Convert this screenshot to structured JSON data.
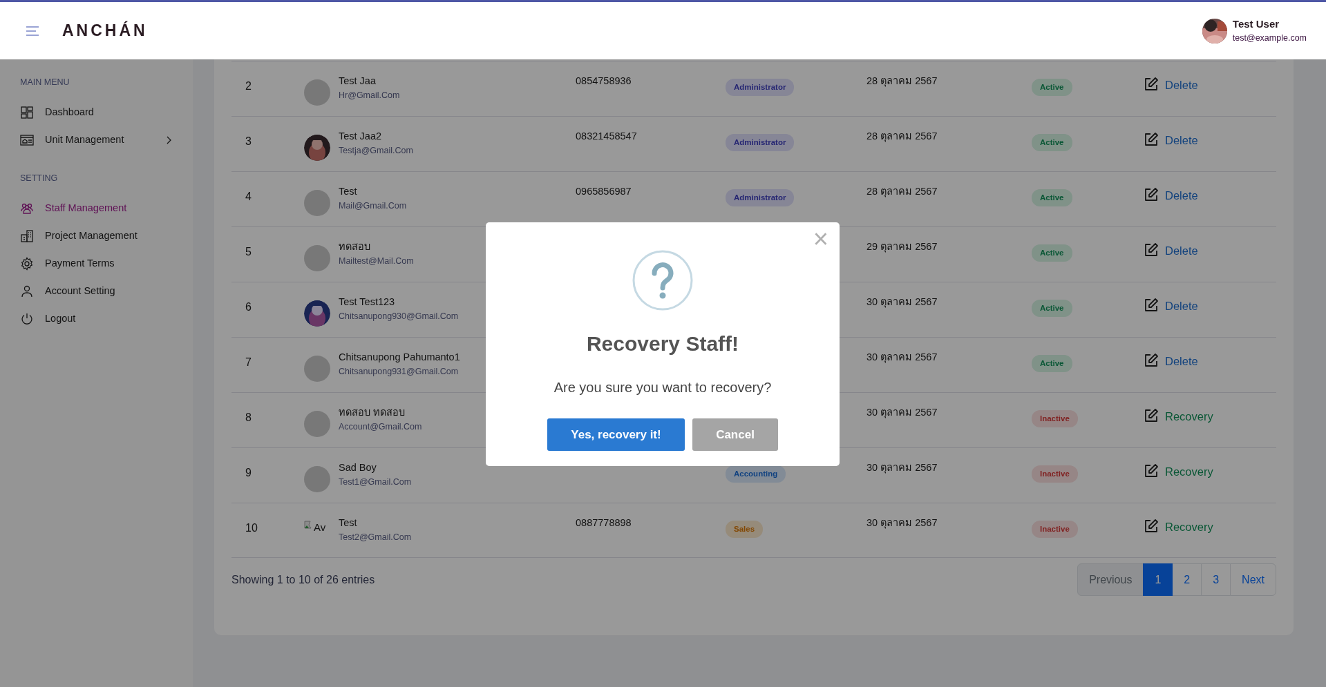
{
  "header": {
    "logo": "ANCHÁN",
    "user": {
      "name": "Test User",
      "email": "test@example.com"
    }
  },
  "sidebar": {
    "sections": [
      {
        "title": "MAIN MENU",
        "items": [
          {
            "label": "Dashboard",
            "kind": "link",
            "selected": false
          },
          {
            "label": "Unit Management",
            "kind": "submenu",
            "selected": false
          }
        ]
      },
      {
        "title": "SETTING",
        "items": [
          {
            "label": "Staff Management",
            "kind": "link",
            "selected": true
          },
          {
            "label": "Project Management",
            "kind": "link",
            "selected": false
          },
          {
            "label": "Payment Terms",
            "kind": "link",
            "selected": false
          },
          {
            "label": "Account Setting",
            "kind": "link",
            "selected": false
          },
          {
            "label": "Logout",
            "kind": "link",
            "selected": false
          }
        ]
      }
    ]
  },
  "staff_table": {
    "rows": [
      {
        "number": "2",
        "avatar": {
          "kind": "placeholder"
        },
        "name": "Test Jaa",
        "email": "Hr@Gmail.Com",
        "phone": "0854758936",
        "role": {
          "label": "Administrator",
          "kind": "admin"
        },
        "date": "28 ตุลาคม 2567",
        "status": "Active",
        "active": true,
        "action": "Delete"
      },
      {
        "number": "3",
        "name": "Test Jaa2",
        "email": "Testja@Gmail.Com",
        "phone": "08321458547",
        "role": {
          "label": "Administrator",
          "kind": "admin"
        },
        "date": "28 ตุลาคม 2567",
        "status": "Active",
        "active": true,
        "action": "Delete"
      },
      {
        "number": "4",
        "avatar": {
          "kind": "placeholder"
        },
        "name": "Test",
        "email": "Mail@Gmail.Com",
        "phone": "0965856987",
        "role": {
          "label": "Administrator",
          "kind": "admin"
        },
        "date": "28 ตุลาคม 2567",
        "status": "Active",
        "active": true,
        "action": "Delete"
      },
      {
        "number": "5",
        "avatar": {
          "kind": "placeholder"
        },
        "name": "ทดสอบ",
        "email": "Mailtest@Mail.Com",
        "date": "29 ตุลาคม 2567",
        "status": "Active",
        "active": true,
        "action": "Delete"
      },
      {
        "number": "6",
        "name": "Test Test123",
        "email": "Chitsanupong930@Gmail.Com",
        "date": "30 ตุลาคม 2567",
        "status": "Active",
        "active": true,
        "action": "Delete"
      },
      {
        "number": "7",
        "avatar": {
          "kind": "placeholder"
        },
        "name": "Chitsanupong Pahumanto1",
        "email": "Chitsanupong931@Gmail.Com",
        "date": "30 ตุลาคม 2567",
        "status": "Active",
        "active": true,
        "action": "Delete"
      },
      {
        "number": "8",
        "avatar": {
          "kind": "placeholder"
        },
        "name": "ทดสอบ ทดสอบ",
        "email": "Account@Gmail.Com",
        "date": "30 ตุลาคม 2567",
        "status": "Inactive",
        "active": false,
        "action": "Recovery"
      },
      {
        "number": "9",
        "avatar": {
          "kind": "placeholder"
        },
        "name": "Sad Boy",
        "email": "Test1@Gmail.Com",
        "role": {
          "label": "Accounting",
          "kind": "accounting"
        },
        "date": "30 ตุลาคม 2567",
        "status": "Inactive",
        "active": false,
        "action": "Recovery"
      },
      {
        "number": "10",
        "avatar": {
          "kind": "broken",
          "alt_text": "Av"
        },
        "name": "Test",
        "email": "Test2@Gmail.Com",
        "phone": "0887778898",
        "role": {
          "label": "Sales",
          "kind": "sales"
        },
        "date": "30 ตุลาคม 2567",
        "status": "Inactive",
        "active": false,
        "action": "Recovery"
      }
    ]
  },
  "pagination": {
    "info": "Showing 1 to 10 of 26 entries",
    "pages": [
      {
        "label": "Previous",
        "selected": false,
        "disabled": true
      },
      {
        "label": "1",
        "selected": true,
        "disabled": false
      },
      {
        "label": "2",
        "selected": false,
        "disabled": false
      },
      {
        "label": "3",
        "selected": false,
        "disabled": false
      },
      {
        "label": "Next",
        "selected": false,
        "disabled": false
      }
    ]
  },
  "dialog": {
    "close": "×",
    "title": "Recovery Staff!",
    "message": "Are you sure you want to recovery?",
    "confirm": "Yes, recovery it!",
    "cancel": "Cancel"
  }
}
